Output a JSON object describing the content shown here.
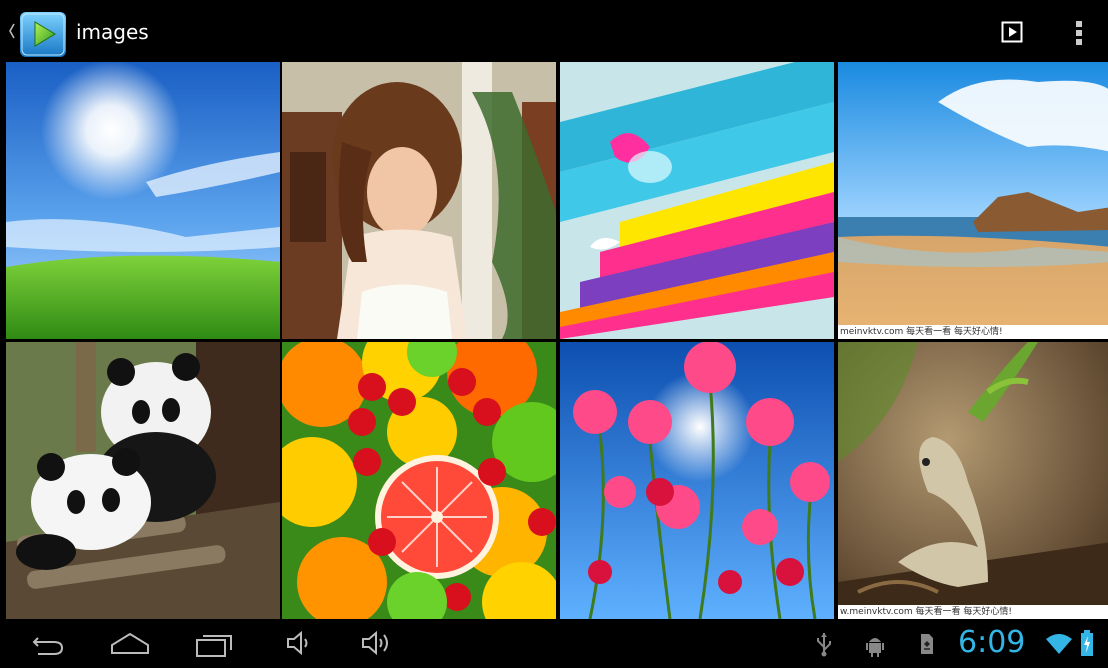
{
  "action_bar": {
    "title": "images",
    "app_icon": "gallery-play-icon",
    "actions": [
      {
        "name": "slideshow",
        "icon": "play-box-icon"
      },
      {
        "name": "overflow-menu",
        "icon": "vertical-dots-icon"
      }
    ]
  },
  "grid": {
    "columns": 4,
    "rows": 2,
    "items": [
      {
        "subject": "sky and grass",
        "watermark": ""
      },
      {
        "subject": "woman portrait",
        "watermark": ""
      },
      {
        "subject": "abstract ribbons",
        "watermark": ""
      },
      {
        "subject": "beach with rocks",
        "watermark": "meinvktv.com  每天看一看 每天好心情!"
      },
      {
        "subject": "pandas",
        "watermark": ""
      },
      {
        "subject": "fruits",
        "watermark": ""
      },
      {
        "subject": "poppy flowers",
        "watermark": ""
      },
      {
        "subject": "lizard",
        "watermark": "w.meinvktv.com  每天看一看 每天好心情!"
      }
    ]
  },
  "nav_bar": {
    "buttons": [
      "back-icon",
      "home-icon",
      "recent-apps-icon",
      "volume-down-icon",
      "volume-up-icon"
    ],
    "status": {
      "time": "6:09",
      "icons": [
        "usb-icon",
        "android-debug-icon",
        "sd-card-icon",
        "wifi-icon",
        "battery-charging-icon"
      ]
    }
  },
  "colors": {
    "background": "#000000",
    "clock": "#33b5e5",
    "wifi": "#33b5e5"
  }
}
